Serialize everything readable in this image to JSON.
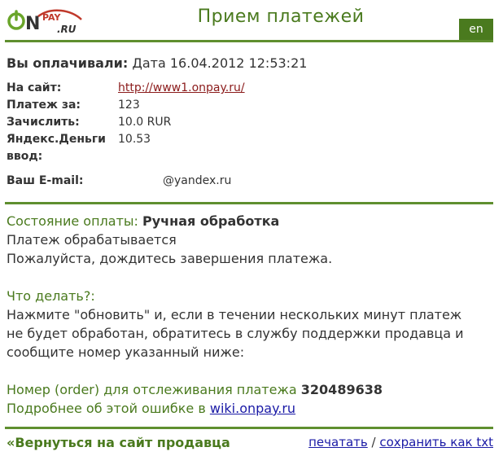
{
  "header": {
    "logo_text": "ONPAY.RU",
    "title": "Прием платежей",
    "lang_button": "en"
  },
  "summary": {
    "paid_label": "Вы оплачивали:",
    "date_label": "Дата",
    "date_value": "16.04.2012 12:53:21"
  },
  "details": {
    "site_label": "На сайт:",
    "site_url": "http://www1.onpay.ru/",
    "payment_for_label": "Платеж за:",
    "payment_for_value": "123",
    "credit_label": "Зачислить:",
    "credit_value": "10.0 RUR",
    "input_label_1": "Яндекс.Деньги",
    "input_label_2": "ввод:",
    "input_value": "10.53",
    "email_label": "Ваш E-mail:",
    "email_value": "@yandex.ru"
  },
  "status": {
    "state_label": "Состояние оплаты:",
    "state_value": "Ручная обработка",
    "line1": "Платеж обрабатывается",
    "line2": "Пожалуйста, дождитесь завершения платежа.",
    "what_todo": "Что делать?:",
    "instr1": "Нажмите \"обновить\" и, если в течении нескольких минут платеж",
    "instr2": "не будет обработан, обратитесь в службу поддержки продавца и",
    "instr3": "сообщите номер указанный ниже:",
    "order_label": "Номер (order) для отслеживания платежа",
    "order_value": "320489638",
    "more_label": "Подробнее об этой ошибке в",
    "more_link": "wiki.onpay.ru"
  },
  "footer": {
    "back_label": "«Вернуться на сайт продавца",
    "print_label": "печатать",
    "separator": "/",
    "save_label": "сохранить как txt"
  },
  "colors": {
    "brand_green": "#4a7a1e",
    "link_dark_red": "#8b1b1b",
    "link_blue": "#1a1aa6"
  }
}
